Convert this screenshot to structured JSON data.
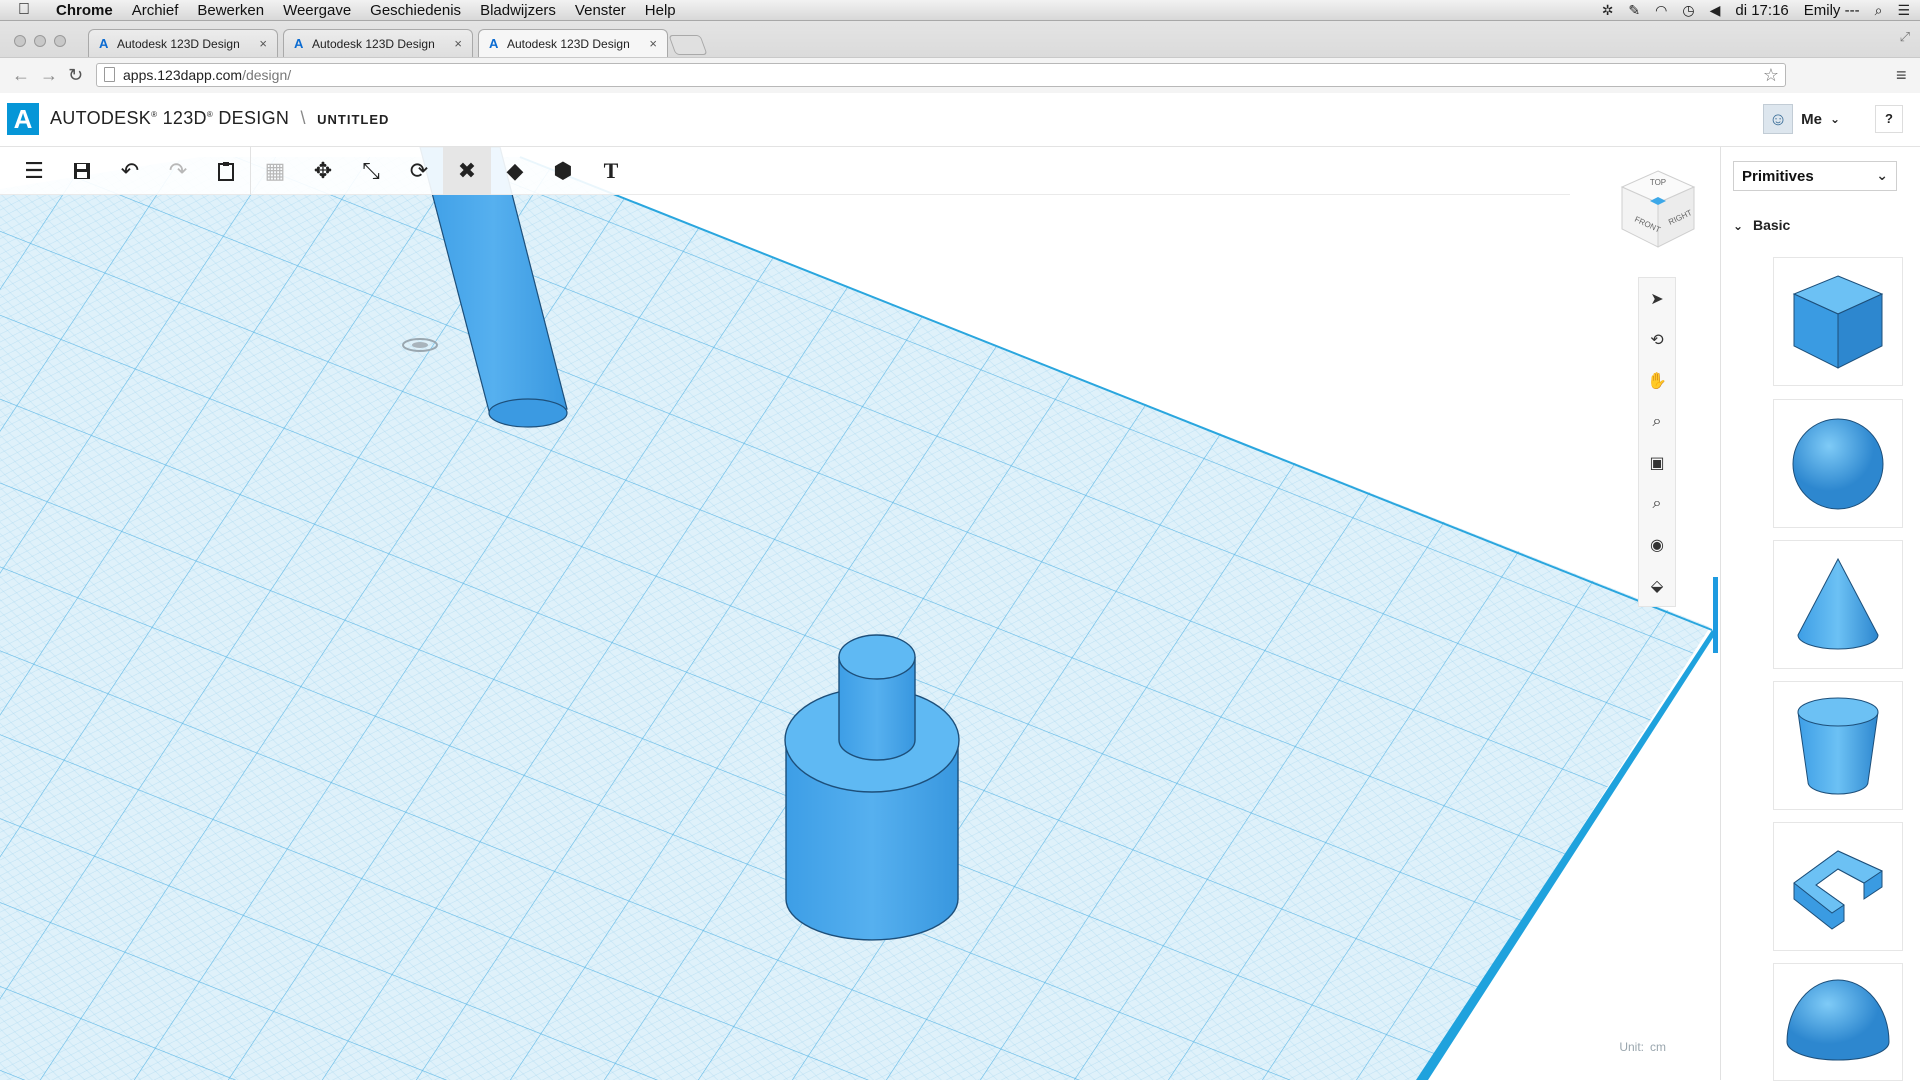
{
  "os_menubar": {
    "apple": "",
    "items": [
      "Chrome",
      "Archief",
      "Bewerken",
      "Weergave",
      "Geschiedenis",
      "Bladwijzers",
      "Venster",
      "Help"
    ],
    "clock": "di 17:16",
    "user": "Emily ---"
  },
  "browser": {
    "tabs": [
      {
        "title": "Autodesk 123D Design",
        "close": "×"
      },
      {
        "title": "Autodesk 123D Design",
        "close": "×"
      },
      {
        "title": "Autodesk 123D Design",
        "close": "×"
      }
    ],
    "url_host": "apps.123dapp.com",
    "url_path": "/design/"
  },
  "app": {
    "brand_main": "AUTODESK",
    "brand_product": "123D",
    "brand_suffix": "DESIGN",
    "separator": "\\",
    "doc_name": "UNTITLED",
    "user_label": "Me",
    "help_label": "?"
  },
  "toolbar": {
    "text_tool_label": "T"
  },
  "viewcube": {
    "top": "TOP",
    "front": "FRONT",
    "right": "RIGHT"
  },
  "status": {
    "unit_label": "Unit:",
    "unit_value": "cm"
  },
  "panel": {
    "dropdown_value": "Primitives",
    "section_title": "Basic",
    "shapes": [
      "box",
      "sphere",
      "cone",
      "cylinder",
      "torus-bracket",
      "hemisphere"
    ]
  },
  "colors": {
    "accent": "#1e9be0",
    "shape_fill": "#4aa9ea",
    "grid_bg": "#d8eef8"
  }
}
